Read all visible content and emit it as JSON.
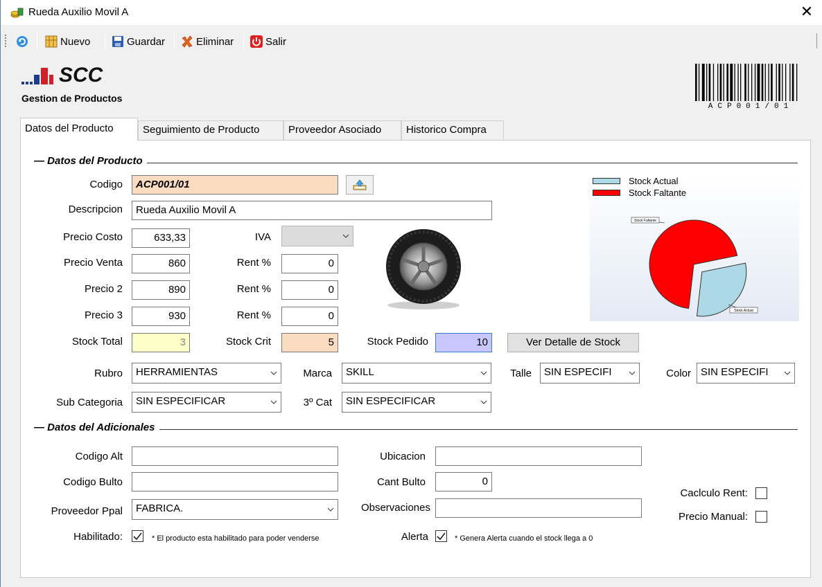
{
  "window": {
    "title": "Rueda Auxilio Movil A",
    "close_glyph": "✕"
  },
  "toolbar": {
    "items": [
      {
        "icon": "refresh-icon",
        "label": ""
      },
      {
        "icon": "new-icon",
        "label": "Nuevo"
      },
      {
        "icon": "save-icon",
        "label": "Guardar"
      },
      {
        "icon": "delete-icon",
        "label": "Eliminar"
      },
      {
        "icon": "power-icon",
        "label": "Salir"
      }
    ]
  },
  "header": {
    "logo_text": "SCC",
    "subtitle": "Gestion de Productos",
    "barcode_text": "ACP001/01"
  },
  "tabs": [
    {
      "label": "Datos del Producto",
      "active": true
    },
    {
      "label": "Seguimiento de Producto",
      "active": false
    },
    {
      "label": "Proveedor Asociado",
      "active": false
    },
    {
      "label": "Historico Compra",
      "active": false
    }
  ],
  "product": {
    "section_title": "Datos del Producto",
    "codigo_label": "Codigo",
    "codigo_value": "ACP001/01",
    "descripcion_label": "Descripcion",
    "descripcion_value": "Rueda Auxilio Movil A",
    "precio_costo_label": "Precio Costo",
    "precio_costo_value": "633,33",
    "iva_label": "IVA",
    "iva_value": "",
    "precio_venta_label": "Precio Venta",
    "precio_venta_value": "860",
    "precio2_label": "Precio 2",
    "precio2_value": "890",
    "precio3_label": "Precio 3",
    "precio3_value": "930",
    "rent_label": "Rent %",
    "rent_venta": "0",
    "rent_2": "0",
    "rent_3": "0",
    "stock_total_label": "Stock Total",
    "stock_total_value": "3",
    "stock_crit_label": "Stock Crit",
    "stock_crit_value": "5",
    "stock_pedido_label": "Stock Pedido",
    "stock_pedido_value": "10",
    "ver_detalle_label": "Ver Detalle de Stock",
    "rubro_label": "Rubro",
    "rubro_value": "HERRAMIENTAS",
    "marca_label": "Marca",
    "marca_value": "SKILL",
    "talle_label": "Talle",
    "talle_value": "SIN ESPECIFI",
    "color_label": "Color",
    "color_value": "SIN ESPECIFI",
    "subcat_label": "Sub Categoria",
    "subcat_value": "SIN ESPECIFICAR",
    "cat3_label": "3º Cat",
    "cat3_value": "SIN ESPECIFICAR"
  },
  "chart_data": {
    "type": "pie",
    "title": "",
    "series": [
      {
        "name": "Stock Actual",
        "value": 3,
        "color": "#add8e6"
      },
      {
        "name": "Stock Faltante",
        "value": 7,
        "color": "#ff0000"
      }
    ],
    "legend": "top",
    "slice_labels": [
      "Stock Faltante",
      "Stock Actual"
    ]
  },
  "extra": {
    "section_title": "Datos del Adicionales",
    "codigo_alt_label": "Codigo Alt",
    "codigo_alt_value": "",
    "codigo_bulto_label": "Codigo Bulto",
    "codigo_bulto_value": "",
    "proveedor_label": "Proveedor Ppal",
    "proveedor_value": "FABRICA.",
    "ubicacion_label": "Ubicacion",
    "ubicacion_value": "",
    "cant_bulto_label": "Cant Bulto",
    "cant_bulto_value": "0",
    "observaciones_label": "Observaciones",
    "observaciones_value": "",
    "calculo_rent_label": "Caclculo Rent:",
    "calculo_rent_checked": false,
    "precio_manual_label": "Precio Manual:",
    "precio_manual_checked": false,
    "habilitado_label": "Habilitado:",
    "habilitado_checked": true,
    "habilitado_note": "* El producto esta habilitado para poder venderse",
    "alerta_label": "Alerta",
    "alerta_checked": true,
    "alerta_note": "* Genera Alerta cuando el stock llega a 0"
  },
  "colors": {
    "codigo_bg": "#fcdcc0",
    "stock_total_bg": "#ffffc8",
    "stock_crit_bg": "#fcdcc0",
    "stock_pedido_bg": "#c8c8ff",
    "pie_red": "#ff0000",
    "pie_blue": "#add8e6"
  }
}
